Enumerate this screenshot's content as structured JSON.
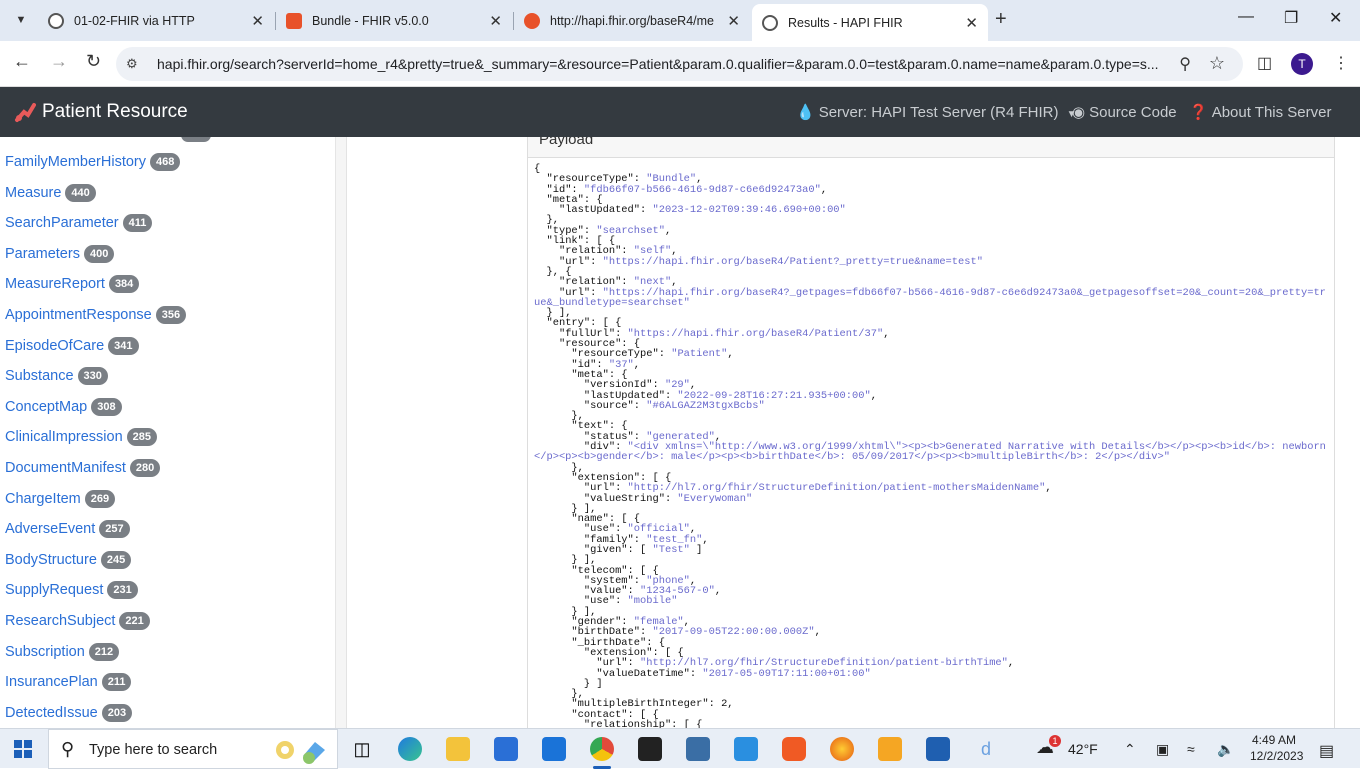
{
  "browser": {
    "tabs": [
      {
        "title": "01-02-FHIR via HTTP"
      },
      {
        "title": "Bundle - FHIR v5.0.0"
      },
      {
        "title": "http://hapi.fhir.org/baseR4/me"
      },
      {
        "title": "Results - HAPI FHIR"
      }
    ],
    "url": "hapi.fhir.org/search?serverId=home_r4&pretty=true&_summary=&resource=Patient&param.0.qualifier=&param.0.0=test&param.0.name=name&param.0.type=s...",
    "profile_initial": "T"
  },
  "app": {
    "title": "Patient Resource",
    "server_label": "Server: HAPI Test Server (R4 FHIR)",
    "source_code_label": "Source Code",
    "about_label": "About This Server"
  },
  "sidebar": {
    "items": [
      {
        "label": "FamilyMemberHistory",
        "count": "468"
      },
      {
        "label": "Measure",
        "count": "440"
      },
      {
        "label": "SearchParameter",
        "count": "411"
      },
      {
        "label": "Parameters",
        "count": "400"
      },
      {
        "label": "MeasureReport",
        "count": "384"
      },
      {
        "label": "AppointmentResponse",
        "count": "356"
      },
      {
        "label": "EpisodeOfCare",
        "count": "341"
      },
      {
        "label": "Substance",
        "count": "330"
      },
      {
        "label": "ConceptMap",
        "count": "308"
      },
      {
        "label": "ClinicalImpression",
        "count": "285"
      },
      {
        "label": "DocumentManifest",
        "count": "280"
      },
      {
        "label": "ChargeItem",
        "count": "269"
      },
      {
        "label": "AdverseEvent",
        "count": "257"
      },
      {
        "label": "BodyStructure",
        "count": "245"
      },
      {
        "label": "SupplyRequest",
        "count": "231"
      },
      {
        "label": "ResearchSubject",
        "count": "221"
      },
      {
        "label": "Subscription",
        "count": "212"
      },
      {
        "label": "InsurancePlan",
        "count": "211"
      },
      {
        "label": "DetectedIssue",
        "count": "203"
      }
    ]
  },
  "payload": {
    "heading": "Payload",
    "lines": [
      [
        [
          "{",
          ""
        ]
      ],
      [
        [
          "  \"resourceType\": ",
          ""
        ],
        [
          "\"Bundle\"",
          "s"
        ],
        [
          ",",
          ""
        ]
      ],
      [
        [
          "  \"id\": ",
          ""
        ],
        [
          "\"fdb66f07-b566-4616-9d87-c6e6d92473a0\"",
          "s"
        ],
        [
          ",",
          ""
        ]
      ],
      [
        [
          "  \"meta\": {",
          ""
        ]
      ],
      [
        [
          "    \"lastUpdated\": ",
          ""
        ],
        [
          "\"2023-12-02T09:39:46.690+00:00\"",
          "s"
        ]
      ],
      [
        [
          "  },",
          ""
        ]
      ],
      [
        [
          "  \"type\": ",
          ""
        ],
        [
          "\"searchset\"",
          "s"
        ],
        [
          ",",
          ""
        ]
      ],
      [
        [
          "  \"link\": [ {",
          ""
        ]
      ],
      [
        [
          "    \"relation\": ",
          ""
        ],
        [
          "\"self\"",
          "s"
        ],
        [
          ",",
          ""
        ]
      ],
      [
        [
          "    \"url\": ",
          ""
        ],
        [
          "\"https://hapi.fhir.org/baseR4/Patient?_pretty=true&name=test\"",
          "s"
        ]
      ],
      [
        [
          "  }, {",
          ""
        ]
      ],
      [
        [
          "    \"relation\": ",
          ""
        ],
        [
          "\"next\"",
          "s"
        ],
        [
          ",",
          ""
        ]
      ],
      [
        [
          "    \"url\": ",
          ""
        ],
        [
          "\"https://hapi.fhir.org/baseR4?_getpages=fdb66f07-b566-4616-9d87-c6e6d92473a0&_getpagesoffset=20&_count=20&_pretty=true&_bundletype=searchset\"",
          "s"
        ]
      ],
      [
        [
          "  } ],",
          ""
        ]
      ],
      [
        [
          "  \"entry\": [ {",
          ""
        ]
      ],
      [
        [
          "    \"fullUrl\": ",
          ""
        ],
        [
          "\"https://hapi.fhir.org/baseR4/Patient/37\"",
          "s"
        ],
        [
          ",",
          ""
        ]
      ],
      [
        [
          "    \"resource\": {",
          ""
        ]
      ],
      [
        [
          "      \"resourceType\": ",
          ""
        ],
        [
          "\"Patient\"",
          "s"
        ],
        [
          ",",
          ""
        ]
      ],
      [
        [
          "      \"id\": ",
          ""
        ],
        [
          "\"37\"",
          "s"
        ],
        [
          ",",
          ""
        ]
      ],
      [
        [
          "      \"meta\": {",
          ""
        ]
      ],
      [
        [
          "        \"versionId\": ",
          ""
        ],
        [
          "\"29\"",
          "s"
        ],
        [
          ",",
          ""
        ]
      ],
      [
        [
          "        \"lastUpdated\": ",
          ""
        ],
        [
          "\"2022-09-28T16:27:21.935+00:00\"",
          "s"
        ],
        [
          ",",
          ""
        ]
      ],
      [
        [
          "        \"source\": ",
          ""
        ],
        [
          "\"#6ALGAZ2M3tgxBcbs\"",
          "s"
        ]
      ],
      [
        [
          "      },",
          ""
        ]
      ],
      [
        [
          "      \"text\": {",
          ""
        ]
      ],
      [
        [
          "        \"status\": ",
          ""
        ],
        [
          "\"generated\"",
          "s"
        ],
        [
          ",",
          ""
        ]
      ],
      [
        [
          "        \"div\": ",
          ""
        ],
        [
          "\"<div xmlns=\\\"http://www.w3.org/1999/xhtml\\\"><p><b>Generated Narrative with Details</b></p><p><b>id</b>: newborn</p><p><b>gender</b>: male</p><p><b>birthDate</b>: 05/09/2017</p><p><b>multipleBirth</b>: 2</p></div>\"",
          "s"
        ]
      ],
      [
        [
          "      },",
          ""
        ]
      ],
      [
        [
          "      \"extension\": [ {",
          ""
        ]
      ],
      [
        [
          "        \"url\": ",
          ""
        ],
        [
          "\"http://hl7.org/fhir/StructureDefinition/patient-mothersMaidenName\"",
          "s"
        ],
        [
          ",",
          ""
        ]
      ],
      [
        [
          "        \"valueString\": ",
          ""
        ],
        [
          "\"Everywoman\"",
          "s"
        ]
      ],
      [
        [
          "      } ],",
          ""
        ]
      ],
      [
        [
          "      \"name\": [ {",
          ""
        ]
      ],
      [
        [
          "        \"use\": ",
          ""
        ],
        [
          "\"official\"",
          "s"
        ],
        [
          ",",
          ""
        ]
      ],
      [
        [
          "        \"family\": ",
          ""
        ],
        [
          "\"test_fn\"",
          "s"
        ],
        [
          ",",
          ""
        ]
      ],
      [
        [
          "        \"given\": [ ",
          ""
        ],
        [
          "\"Test\"",
          "s"
        ],
        [
          " ]",
          ""
        ]
      ],
      [
        [
          "      } ],",
          ""
        ]
      ],
      [
        [
          "      \"telecom\": [ {",
          ""
        ]
      ],
      [
        [
          "        \"system\": ",
          ""
        ],
        [
          "\"phone\"",
          "s"
        ],
        [
          ",",
          ""
        ]
      ],
      [
        [
          "        \"value\": ",
          ""
        ],
        [
          "\"1234-567-0\"",
          "s"
        ],
        [
          ",",
          ""
        ]
      ],
      [
        [
          "        \"use\": ",
          ""
        ],
        [
          "\"mobile\"",
          "s"
        ]
      ],
      [
        [
          "      } ],",
          ""
        ]
      ],
      [
        [
          "      \"gender\": ",
          ""
        ],
        [
          "\"female\"",
          "s"
        ],
        [
          ",",
          ""
        ]
      ],
      [
        [
          "      \"birthDate\": ",
          ""
        ],
        [
          "\"2017-09-05T22:00:00.000Z\"",
          "s"
        ],
        [
          ",",
          ""
        ]
      ],
      [
        [
          "      \"_birthDate\": {",
          ""
        ]
      ],
      [
        [
          "        \"extension\": [ {",
          ""
        ]
      ],
      [
        [
          "          \"url\": ",
          ""
        ],
        [
          "\"http://hl7.org/fhir/StructureDefinition/patient-birthTime\"",
          "s"
        ],
        [
          ",",
          ""
        ]
      ],
      [
        [
          "          \"valueDateTime\": ",
          ""
        ],
        [
          "\"2017-05-09T17:11:00+01:00\"",
          "s"
        ]
      ],
      [
        [
          "        } ]",
          ""
        ]
      ],
      [
        [
          "      },",
          ""
        ]
      ],
      [
        [
          "      \"multipleBirthInteger\": 2,",
          ""
        ]
      ],
      [
        [
          "      \"contact\": [ {",
          ""
        ]
      ],
      [
        [
          "        \"relationship\": [ {",
          ""
        ]
      ]
    ]
  },
  "taskbar": {
    "search_placeholder": "Type here to search",
    "temperature": "42°F",
    "time": "4:49 AM",
    "date": "12/2/2023",
    "weather_badge": "1"
  },
  "colors": {
    "tabstrip": "#e2e9f3",
    "appbar": "#343a40",
    "link": "#2a6fd6",
    "badge": "#7a7f85",
    "json_string": "#6a6acd"
  }
}
